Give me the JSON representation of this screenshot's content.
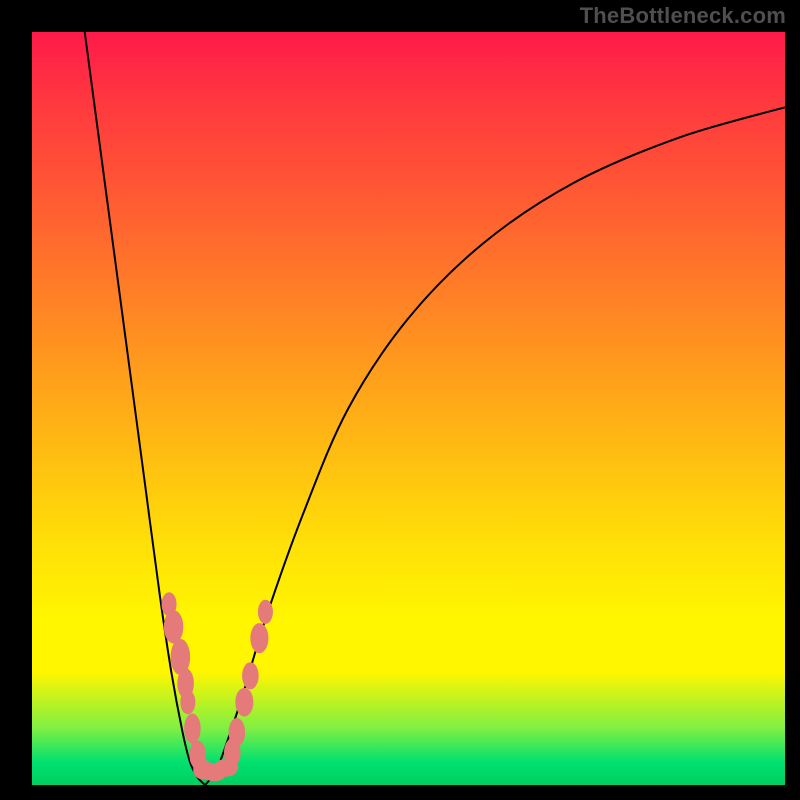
{
  "watermark": "TheBottleneck.com",
  "chart_data": {
    "type": "line",
    "title": "",
    "xlabel": "",
    "ylabel": "",
    "xlim": [
      0,
      100
    ],
    "ylim": [
      0,
      100
    ],
    "grid": false,
    "series": [
      {
        "name": "left-curve",
        "x": [
          7,
          9,
          11,
          13,
          15,
          17,
          18.5,
          20,
          21,
          22,
          23
        ],
        "y": [
          100,
          85,
          70,
          55,
          40,
          25,
          15,
          7,
          3,
          1,
          0
        ]
      },
      {
        "name": "right-curve",
        "x": [
          23,
          24.5,
          26,
          28,
          31,
          36,
          42,
          50,
          60,
          72,
          86,
          100
        ],
        "y": [
          0,
          2,
          6,
          12,
          22,
          36,
          50,
          62,
          72,
          80,
          86,
          90
        ]
      }
    ],
    "markers": [
      {
        "x": 18.2,
        "y": 24,
        "rx": 1.0,
        "ry": 1.6
      },
      {
        "x": 18.8,
        "y": 21,
        "rx": 1.3,
        "ry": 2.2
      },
      {
        "x": 19.7,
        "y": 17,
        "rx": 1.3,
        "ry": 2.4
      },
      {
        "x": 20.4,
        "y": 13.5,
        "rx": 1.1,
        "ry": 2.0
      },
      {
        "x": 20.7,
        "y": 11,
        "rx": 1.0,
        "ry": 1.6
      },
      {
        "x": 21.3,
        "y": 7.5,
        "rx": 1.1,
        "ry": 2.0
      },
      {
        "x": 22.0,
        "y": 4.0,
        "rx": 1.1,
        "ry": 1.9
      },
      {
        "x": 22.8,
        "y": 2.0,
        "rx": 1.4,
        "ry": 1.3
      },
      {
        "x": 24.2,
        "y": 1.7,
        "rx": 1.7,
        "ry": 1.2
      },
      {
        "x": 25.8,
        "y": 2.3,
        "rx": 1.6,
        "ry": 1.2
      },
      {
        "x": 26.6,
        "y": 4.3,
        "rx": 1.1,
        "ry": 1.9
      },
      {
        "x": 27.2,
        "y": 7.0,
        "rx": 1.1,
        "ry": 1.9
      },
      {
        "x": 28.2,
        "y": 11.0,
        "rx": 1.2,
        "ry": 1.9
      },
      {
        "x": 29.0,
        "y": 14.5,
        "rx": 1.1,
        "ry": 1.8
      },
      {
        "x": 30.2,
        "y": 19.5,
        "rx": 1.2,
        "ry": 2.0
      },
      {
        "x": 31.0,
        "y": 23.0,
        "rx": 1.0,
        "ry": 1.6
      }
    ],
    "background_gradient": {
      "top": "#ff1a4a",
      "mid_upper": "#ff7a28",
      "mid": "#ffe008",
      "mid_lower": "#fff600",
      "bottom": "#00d060"
    }
  }
}
